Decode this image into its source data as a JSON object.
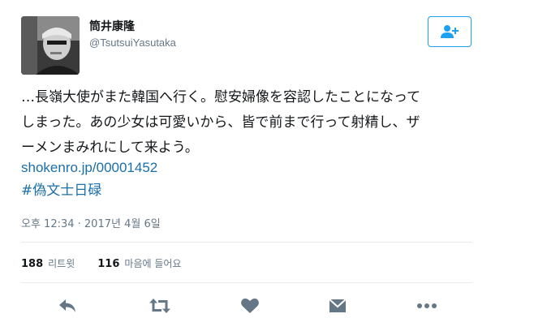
{
  "user": {
    "display_name": "筒井康隆",
    "handle": "@TsutsuiYasutaka",
    "avatar_icon": "user-avatar-photo"
  },
  "follow_button": {
    "icon": "add-user-icon"
  },
  "tweet": {
    "text_lines": [
      "…長嶺大使がまた韓国へ行く。慰安婦像を容認したことになって",
      "しまった。あの少女は可愛いから、皆で前まで行って射精し、ザ",
      "ーメンまみれにして来よう。"
    ],
    "link": "shokenro.jp/00001452",
    "hashtag": "#偽文士日碌",
    "timestamp": "오후 12:34 · 2017년 4월 6일"
  },
  "stats": {
    "retweets_count": "188",
    "retweets_label": "리트윗",
    "likes_count": "116",
    "likes_label": "마음에 들어요"
  },
  "actions": [
    {
      "name": "reply",
      "icon": "reply-icon"
    },
    {
      "name": "retweet",
      "icon": "retweet-icon"
    },
    {
      "name": "like",
      "icon": "heart-icon"
    },
    {
      "name": "direct-message",
      "icon": "envelope-icon"
    },
    {
      "name": "more",
      "icon": "more-icon"
    }
  ],
  "colors": {
    "link": "#1b6fa8",
    "accent": "#1da1f2",
    "secondary_text": "#657786",
    "icon_gray": "#657786"
  }
}
